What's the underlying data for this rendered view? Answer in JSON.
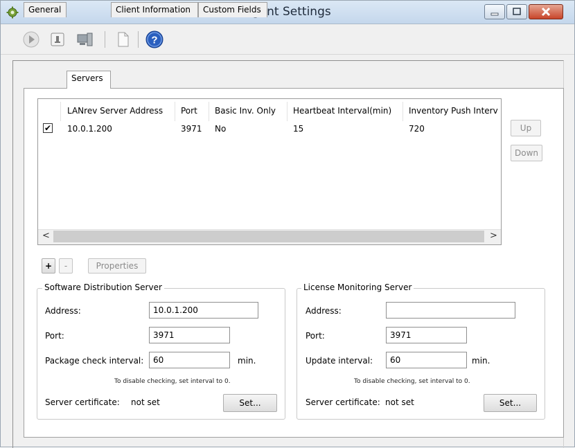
{
  "window": {
    "title": "Agent Settings"
  },
  "toolbar": {
    "icons": [
      "play-icon",
      "agent-info-icon",
      "computer-icon",
      "document-icon",
      "help-icon"
    ]
  },
  "tabs": [
    "General",
    "Servers",
    "Client Information",
    "Custom Fields"
  ],
  "servers_table": {
    "columns": [
      "LANrev Server Address",
      "Port",
      "Basic Inv. Only",
      "Heartbeat Interval(min)",
      "Inventory Push Interv"
    ],
    "rows": [
      {
        "checked": "✔",
        "address": "10.0.1.200",
        "port": "3971",
        "basic_inv_only": "No",
        "heartbeat": "15",
        "inventory_push": "720"
      }
    ],
    "scroll_left": "<",
    "scroll_right": ">"
  },
  "reorder": {
    "up": "Up",
    "down": "Down"
  },
  "list_buttons": {
    "add": "+",
    "remove": "-",
    "properties": "Properties"
  },
  "sds": {
    "legend": "Software Distribution Server",
    "address_label": "Address:",
    "address_value": "10.0.1.200",
    "port_label": "Port:",
    "port_value": "3971",
    "interval_label": "Package check interval:",
    "interval_value": "60",
    "interval_unit": "min.",
    "note": "To disable checking, set interval to 0.",
    "cert_label": "Server certificate:",
    "cert_value": "not set",
    "set_button": "Set..."
  },
  "lms": {
    "legend": "License Monitoring Server",
    "address_label": "Address:",
    "address_value": "",
    "port_label": "Port:",
    "port_value": "3971",
    "interval_label": "Update interval:",
    "interval_value": "60",
    "interval_unit": "min.",
    "note": "To disable checking, set interval to 0.",
    "cert_label": "Server certificate:",
    "cert_value": "not set",
    "set_button": "Set..."
  },
  "colors": {
    "title_bg": "#c4d7ec",
    "close": "#c8452a",
    "help": "#2a5fbf"
  }
}
